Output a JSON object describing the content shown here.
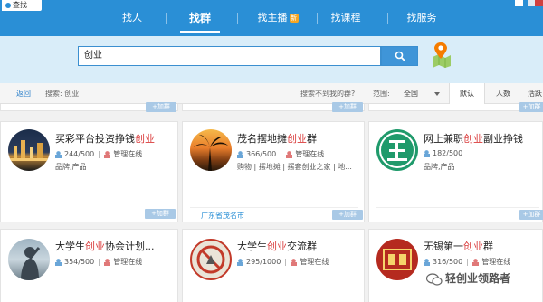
{
  "window": {
    "title": "查找"
  },
  "nav": {
    "items": [
      {
        "label": "找人"
      },
      {
        "label": "找群"
      },
      {
        "label": "找主播",
        "badge": "新"
      },
      {
        "label": "找课程"
      },
      {
        "label": "找服务"
      }
    ],
    "active": "找群"
  },
  "search": {
    "value": "创业"
  },
  "filter": {
    "back": "返回",
    "query_text": "搜索: 创业",
    "not_found": "搜索不到我的群?",
    "scope_label": "范围:",
    "scope_value": "全国",
    "sorts": [
      "默认",
      "人数",
      "活跃"
    ],
    "active_sort": "默认"
  },
  "card_common": {
    "add_label": "+加群",
    "admin_label": "管理在线"
  },
  "cards": [
    {
      "title_prefix": "买彩平台投资挣钱",
      "title_hl": "创业",
      "title_suffix": "",
      "members": "244/500",
      "tags": "品牌,产品",
      "location": ""
    },
    {
      "title_prefix": "茂名摆地摊",
      "title_hl": "创业",
      "title_suffix": "群",
      "members": "366/500",
      "tags": "购物 | 摆地摊 | 摆套创业之家 | 地...",
      "location": "广东省茂名市"
    },
    {
      "title_prefix": "网上兼职",
      "title_hl": "创业",
      "title_suffix": "副业挣钱",
      "members": "182/500",
      "tags": "品牌,产品",
      "location": ""
    },
    {
      "title_prefix": "大学生",
      "title_hl": "创业",
      "title_suffix": "协会计划...",
      "members": "354/500",
      "tags": "",
      "location": ""
    },
    {
      "title_prefix": "大学生",
      "title_hl": "创业",
      "title_suffix": "交流群",
      "members": "295/1000",
      "tags": "",
      "location": ""
    },
    {
      "title_prefix": "无锡第一",
      "title_hl": "创业",
      "title_suffix": "群",
      "members": "316/500",
      "tags": "",
      "location": ""
    }
  ],
  "watermark": "轻创业领路者",
  "colors": {
    "brand": "#2a8fd6",
    "highlight": "#d93a3a",
    "add_button": "#a9c9e6"
  }
}
